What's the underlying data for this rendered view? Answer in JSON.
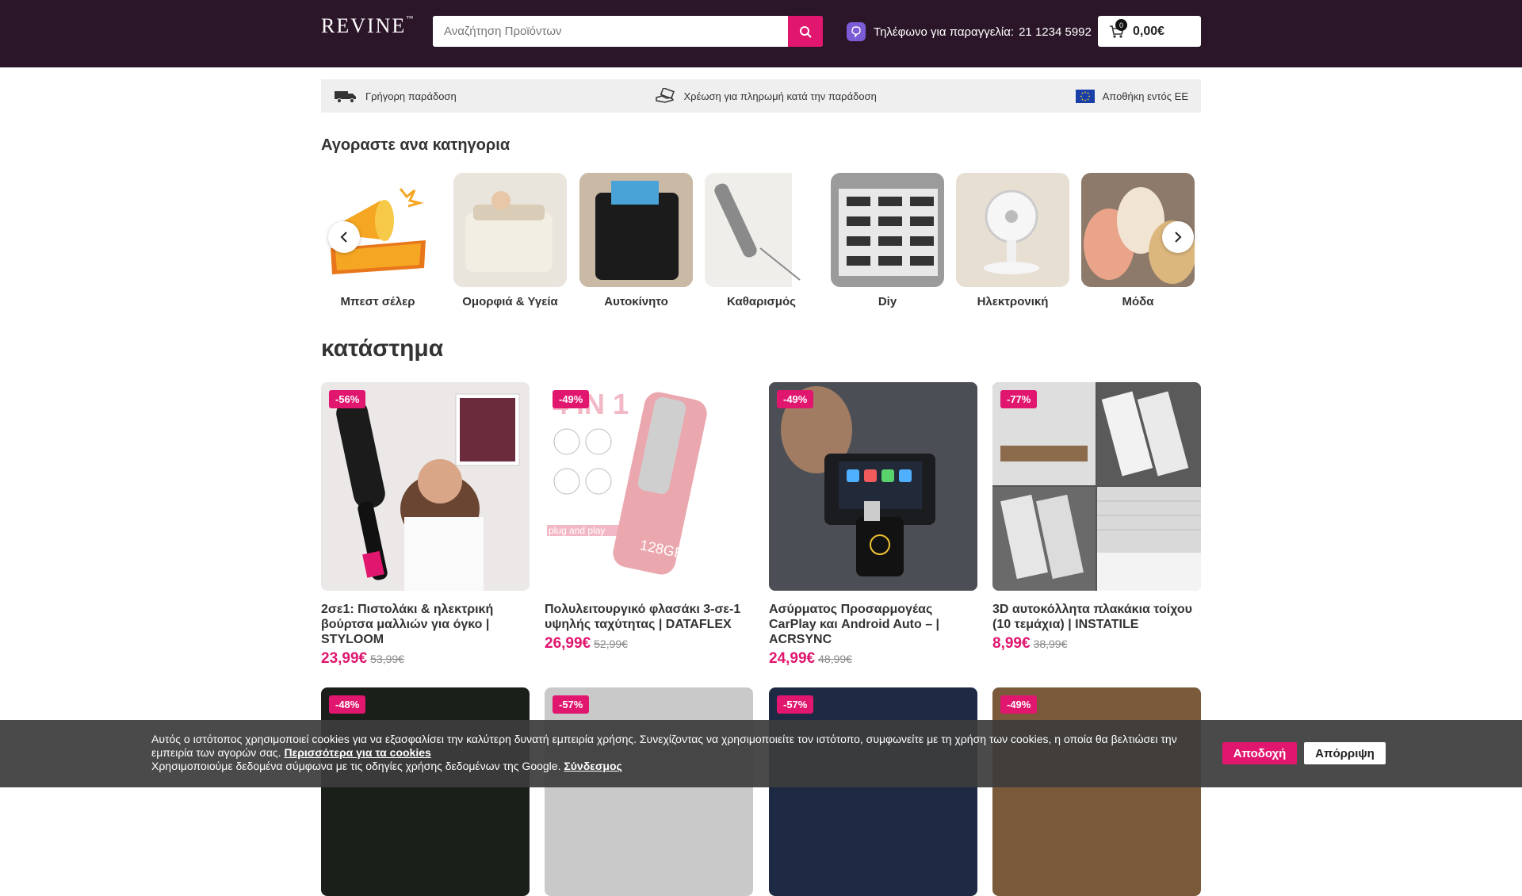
{
  "header": {
    "logo": "REVINE",
    "search_placeholder": "Αναζήτηση Προϊόντων",
    "phone_label": "Τηλέφωνο για παραγγελία:",
    "phone_number": "21 1234 5992",
    "cart_count": "0",
    "cart_total": "0,00€",
    "bg_color": "#2b1528",
    "accent_color": "#e0166f"
  },
  "benefits": [
    {
      "label": "Γρήγορη παράδοση",
      "icon": "truck-icon"
    },
    {
      "label": "Χρέωση για πληρωμή κατά την παράδοση",
      "icon": "cash-hand-icon"
    },
    {
      "label": "Αποθήκη εντός ΕΕ",
      "icon": "eu-flag-icon"
    }
  ],
  "categories_title": "Αγοραστε ανα κατηγορια",
  "categories": [
    {
      "label": "Μπεστ σέλερ"
    },
    {
      "label": "Ομορφιά & Υγεία"
    },
    {
      "label": "Αυτοκίνητο"
    },
    {
      "label": "Καθαρισμός"
    },
    {
      "label": "Diy"
    },
    {
      "label": "Ηλεκτρονική"
    },
    {
      "label": "Μόδα"
    }
  ],
  "shop_title": "κατάστημα",
  "products": [
    {
      "badge": "-56%",
      "name": "2σε1: Πιστολάκι & ηλεκτρική βούρτσα μαλλιών για όγκο | STYLOOM",
      "price": "23,99€",
      "old_price": "53,99€"
    },
    {
      "badge": "-49%",
      "name": "Πολυλειτουργικό φλασάκι 3-σε-1 υψηλής ταχύτητας | DATAFLEX",
      "price": "26,99€",
      "old_price": "52,99€"
    },
    {
      "badge": "-49%",
      "name": "Ασύρματος Προσαρμογέας CarPlay και Android Auto – | ACRSYNC",
      "price": "24,99€",
      "old_price": "48,99€"
    },
    {
      "badge": "-77%",
      "name": "3D αυτοκόλλητα πλακάκια τοίχου (10 τεμάχια) | INSTATILE",
      "price": "8,99€",
      "old_price": "38,99€"
    },
    {
      "badge": "-48%"
    },
    {
      "badge": "-57%"
    },
    {
      "badge": "-57%"
    },
    {
      "badge": "-49%"
    }
  ],
  "product_images": {
    "usb_text_top": "4 IN 1",
    "usb_text_bottom": "plug and play",
    "usb_capacity": "128GB"
  },
  "cookie": {
    "text": "Αυτός ο ιστότοπος χρησιμοποιεί cookies για να εξασφαλίσει την καλύτερη δυνατή εμπειρία χρήσης. Συνεχίζοντας να χρησιμοποιείτε τον ιστότοπο, συμφωνείτε με τη χρήση των cookies, η οποία θα βελτιώσει την εμπειρία των αγορών σας.",
    "more_link": "Περισσότερα για τα cookies",
    "google_text": "Χρησιμοποιούμε δεδομένα σύμφωνα με τις οδηγίες χρήσης δεδομένων της Google.",
    "google_link": "Σύνδεσμος",
    "accept": "Αποδοχή",
    "reject": "Απόρριψη"
  }
}
